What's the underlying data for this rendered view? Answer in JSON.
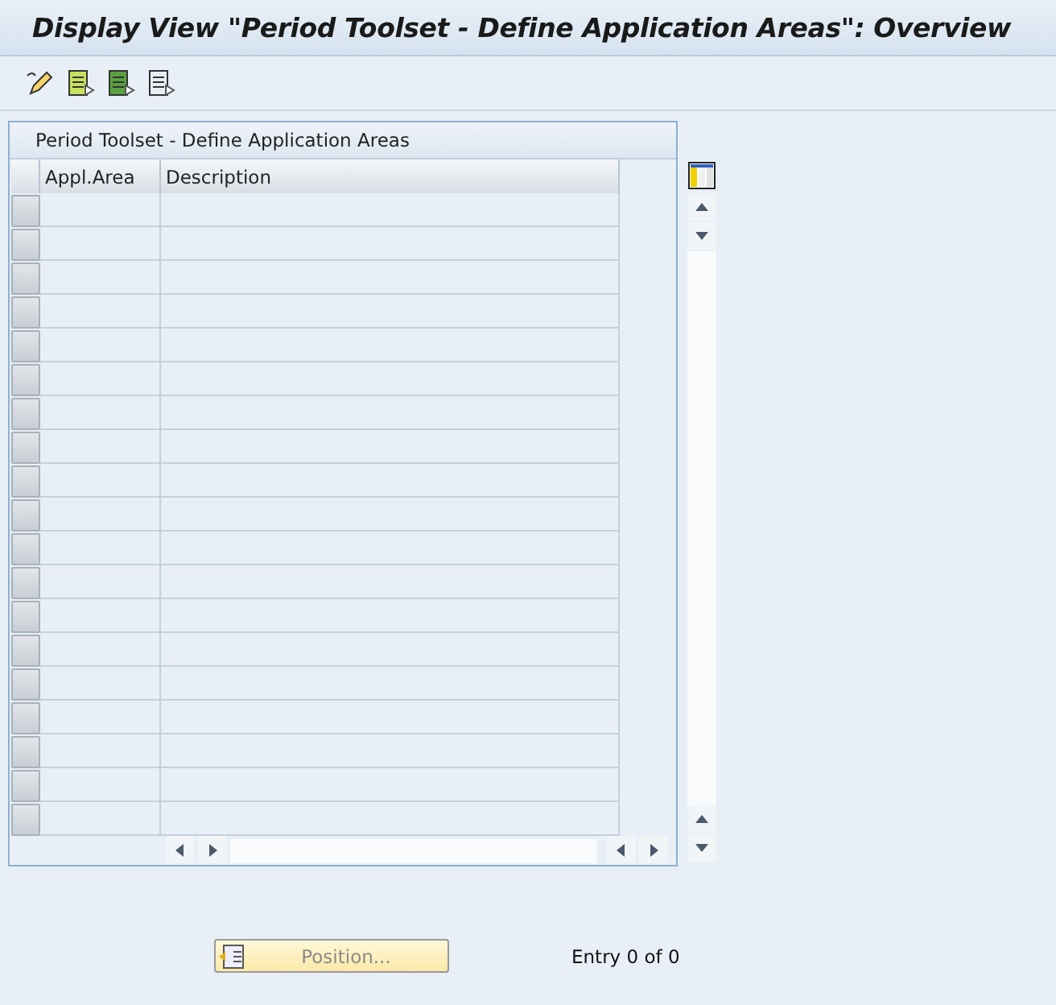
{
  "window": {
    "title": "Display View \"Period Toolset - Define Application Areas\": Overview"
  },
  "table": {
    "title": "Period Toolset - Define Application Areas",
    "columns": [
      "Appl.Area",
      "Description"
    ]
  },
  "position_button": {
    "label": "Position...",
    "disabled": true
  },
  "entry_status": "Entry 0 of 0"
}
